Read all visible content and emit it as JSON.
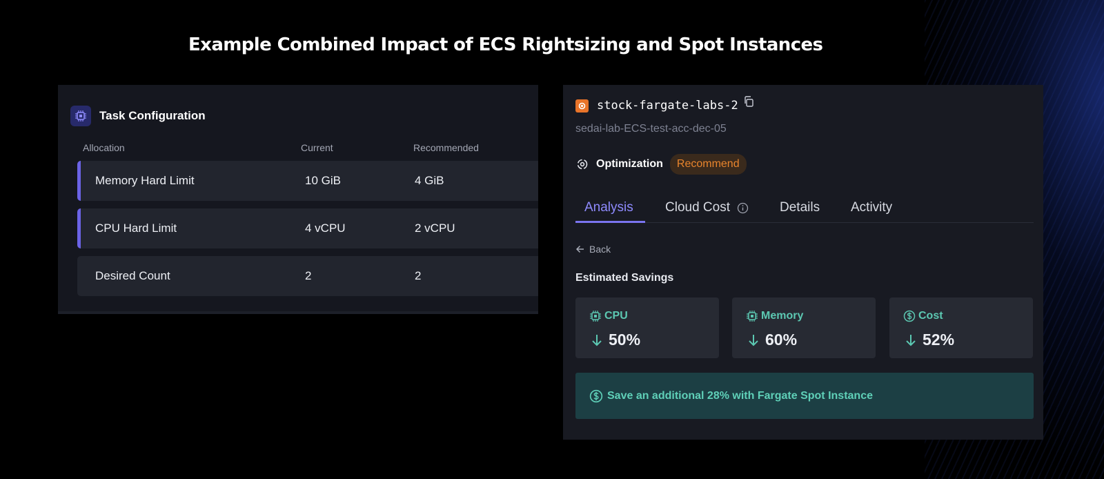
{
  "headline": "Example Combined Impact of ECS Rightsizing and Spot Instances",
  "task_config": {
    "title": "Task Configuration",
    "columns": [
      "Allocation",
      "Current",
      "Recommended"
    ],
    "rows": [
      {
        "allocation": "Memory Hard Limit",
        "current": "10 GiB",
        "recommended": "4 GiB",
        "highlighted": true
      },
      {
        "allocation": "CPU Hard Limit",
        "current": "4 vCPU",
        "recommended": "2 vCPU",
        "highlighted": true
      },
      {
        "allocation": "Desired Count",
        "current": "2",
        "recommended": "2",
        "highlighted": false
      }
    ]
  },
  "service": {
    "name": "stock-fargate-labs-2",
    "subtitle": "sedai-lab-ECS-test-acc-dec-05",
    "optimization_label": "Optimization",
    "optimization_mode": "Recommend"
  },
  "tabs": [
    {
      "label": "Analysis",
      "active": true
    },
    {
      "label": "Cloud Cost",
      "active": false
    },
    {
      "label": "Details",
      "active": false
    },
    {
      "label": "Activity",
      "active": false
    }
  ],
  "back_label": "Back",
  "estimated_savings": {
    "title": "Estimated Savings",
    "cards": [
      {
        "label": "CPU",
        "value": "50%",
        "icon": "chip-icon"
      },
      {
        "label": "Memory",
        "value": "60%",
        "icon": "chip-icon"
      },
      {
        "label": "Cost",
        "value": "52%",
        "icon": "dollar-icon"
      }
    ]
  },
  "spot_banner": "Save an additional 28% with Fargate Spot Instance",
  "colors": {
    "accent": "#7a74f0",
    "teal": "#5fd0b8",
    "orange": "#e9852d"
  }
}
